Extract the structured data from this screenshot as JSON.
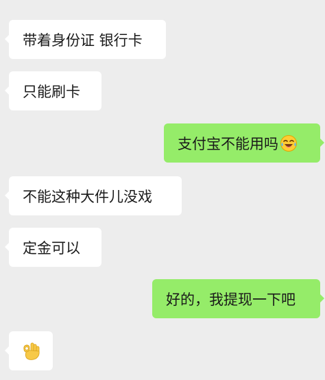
{
  "messages": [
    {
      "id": "m1",
      "side": "incoming",
      "text": "带着身份证 银行卡"
    },
    {
      "id": "m2",
      "side": "incoming",
      "text": "只能刷卡"
    },
    {
      "id": "m3",
      "side": "outgoing",
      "text": "支付宝不能用吗",
      "emoji": "laughing-tears-emoji"
    },
    {
      "id": "m4",
      "side": "incoming",
      "text": "不能这种大件儿没戏"
    },
    {
      "id": "m5",
      "side": "incoming",
      "text": "定金可以"
    },
    {
      "id": "m6",
      "side": "outgoing",
      "text": "好的，我提现一下吧"
    },
    {
      "id": "m7",
      "side": "incoming",
      "text": "",
      "emoji": "ok-hand-emoji"
    }
  ],
  "colors": {
    "background": "#ededed",
    "incoming_bubble": "#ffffff",
    "outgoing_bubble": "#95ec69",
    "text": "#1a1a1a"
  }
}
